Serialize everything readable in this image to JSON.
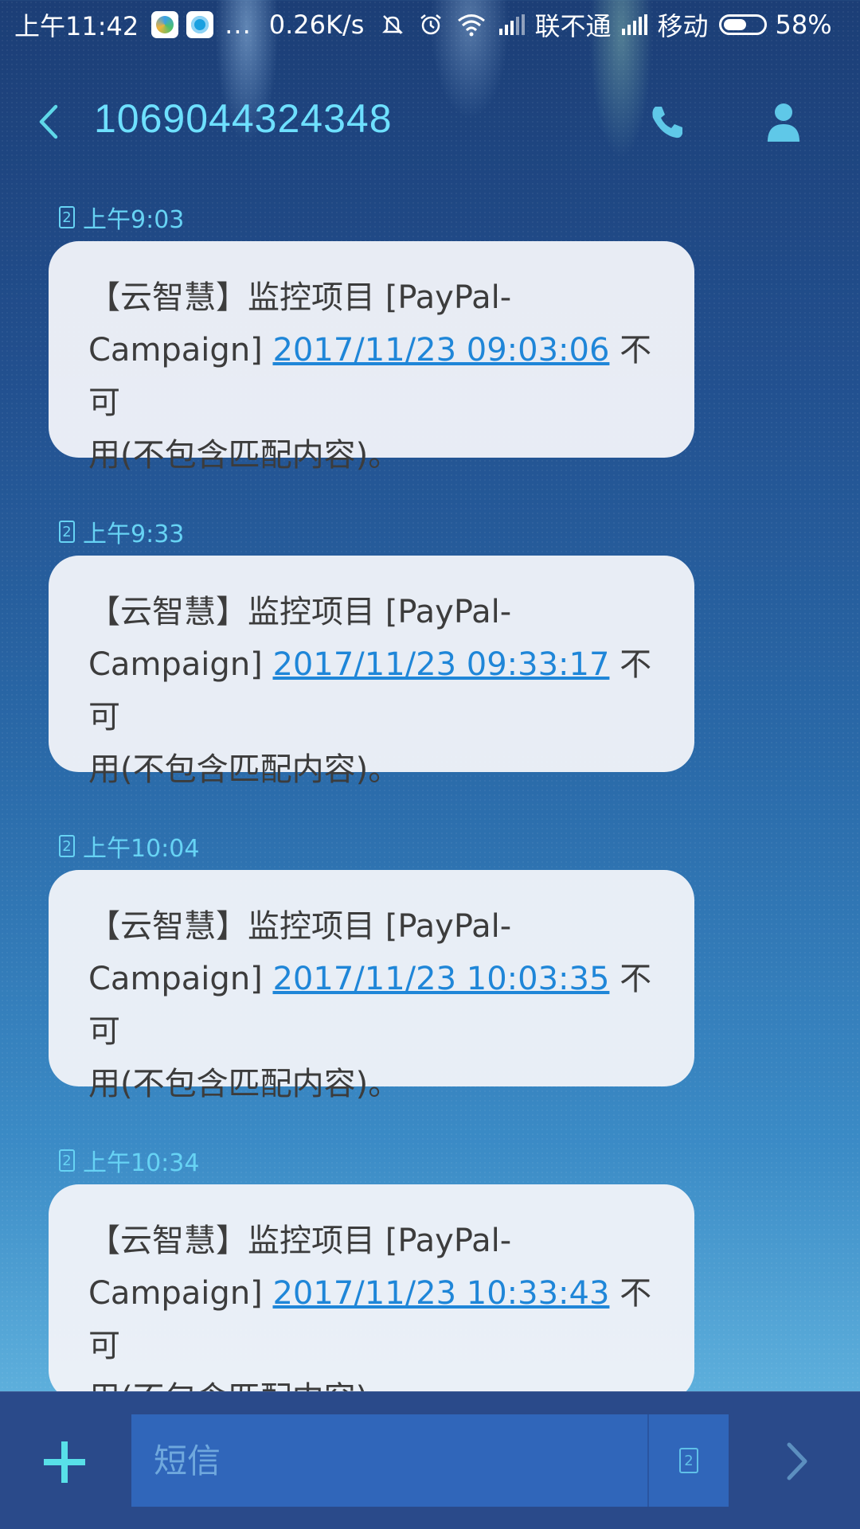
{
  "status_bar": {
    "time": "上午11:42",
    "more": "...",
    "net_speed": "0.26K/s",
    "carrier1": "联不通",
    "carrier2": "移动",
    "battery": "58%",
    "battery_level": 0.58,
    "icons": [
      "app-icon-1",
      "app-icon-2",
      "mute-bell-icon",
      "alarm-icon",
      "wifi-icon",
      "signal-icon",
      "battery-icon"
    ]
  },
  "header": {
    "title": "1069044324348",
    "icons": [
      "back-arrow-icon",
      "phone-icon",
      "contact-icon"
    ]
  },
  "messages": [
    {
      "sim": "2",
      "time": "上午9:03",
      "line1": "【云智慧】监控项目 [PayPal-",
      "prefix": "Campaign] ",
      "link": "2017/11/23 09:03:06",
      "suffix": " 不可",
      "line3": "用(不包含匹配内容)。"
    },
    {
      "sim": "2",
      "time": "上午9:33",
      "line1": "【云智慧】监控项目 [PayPal-",
      "prefix": "Campaign] ",
      "link": "2017/11/23 09:33:17",
      "suffix": " 不可",
      "line3": "用(不包含匹配内容)。"
    },
    {
      "sim": "2",
      "time": "上午10:04",
      "line1": "【云智慧】监控项目 [PayPal-",
      "prefix": "Campaign] ",
      "link": "2017/11/23 10:03:35",
      "suffix": " 不可",
      "line3": "用(不包含匹配内容)。"
    },
    {
      "sim": "2",
      "time": "上午10:34",
      "line1": "【云智慧】监控项目 [PayPal-",
      "prefix": "Campaign] ",
      "link": "2017/11/23 10:33:43",
      "suffix": " 不可",
      "line3": "用(不包含匹配内容)。"
    }
  ],
  "composer": {
    "placeholder": "短信",
    "sim": "2",
    "icons": [
      "plus-icon",
      "sim-card-icon",
      "send-arrow-icon"
    ]
  },
  "colors": {
    "accent": "#6ee0ff",
    "link": "#1f86d8",
    "bubble": "#eef2f8",
    "bottom_bar": "#2a4a8a",
    "input": "#3066ba"
  }
}
